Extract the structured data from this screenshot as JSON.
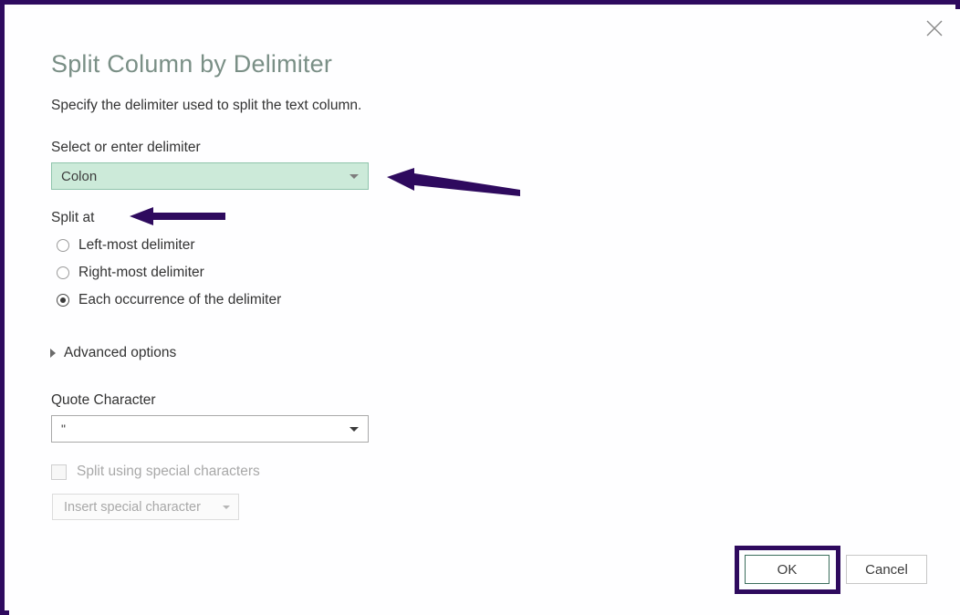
{
  "dialog": {
    "title": "Split Column by Delimiter",
    "subtitle": "Specify the delimiter used to split the text column.",
    "close_label": "Close"
  },
  "delimiter": {
    "label": "Select or enter delimiter",
    "value": "Colon",
    "caret_icon": "chevron-down-icon",
    "highlight_fill": "#ccead9",
    "highlight_border": "#8fc4ac"
  },
  "split_at": {
    "label": "Split at",
    "options": [
      {
        "label": "Left-most delimiter",
        "selected": false
      },
      {
        "label": "Right-most delimiter",
        "selected": false
      },
      {
        "label": "Each occurrence of the delimiter",
        "selected": true
      }
    ]
  },
  "advanced": {
    "label": "Advanced options",
    "expander_icon": "chevron-right-icon",
    "expanded": false
  },
  "quote_character": {
    "label": "Quote Character",
    "value": "\"",
    "caret_icon": "chevron-down-icon"
  },
  "special_characters": {
    "checkbox_label": "Split using special characters",
    "checked": false,
    "enabled": false,
    "button_label": "Insert special character",
    "button_caret_icon": "chevron-down-icon",
    "button_enabled": false
  },
  "footer": {
    "ok_label": "OK",
    "cancel_label": "Cancel"
  },
  "annotations": {
    "frame_color": "#2e0a5e",
    "arrow_color": "#2e0a5e",
    "arrows": [
      {
        "name": "arrow-pointing-to-delimiter-dropdown",
        "direction": "left"
      },
      {
        "name": "arrow-pointing-to-split-at-label",
        "direction": "left"
      }
    ],
    "highlight_box": {
      "target": "ok-button",
      "color": "#2e0a5e"
    }
  }
}
